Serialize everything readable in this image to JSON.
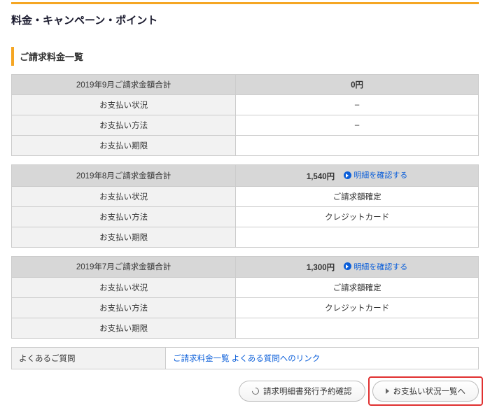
{
  "page_title": "料金・キャンペーン・ポイント",
  "section_heading": "ご請求料金一覧",
  "row_labels": {
    "status": "お支払い状況",
    "method": "お支払い方法",
    "due": "お支払い期限"
  },
  "detail_link_label": "明細を確認する",
  "months": [
    {
      "total_label": "2019年9月ご請求金額合計",
      "amount": "0円",
      "has_detail": false,
      "status": "–",
      "method": "–",
      "due": ""
    },
    {
      "total_label": "2019年8月ご請求金額合計",
      "amount": "1,540円",
      "has_detail": true,
      "status": "ご請求額確定",
      "method": "クレジットカード",
      "due": ""
    },
    {
      "total_label": "2019年7月ご請求金額合計",
      "amount": "1,300円",
      "has_detail": true,
      "status": "ご請求額確定",
      "method": "クレジットカード",
      "due": ""
    }
  ],
  "faq": {
    "label": "よくあるご質問",
    "link_text": "ご請求料金一覧 よくある質問へのリンク"
  },
  "buttons": {
    "statement": "請求明細書発行予約確認",
    "payment_list": "お支払い状況一覧へ"
  }
}
